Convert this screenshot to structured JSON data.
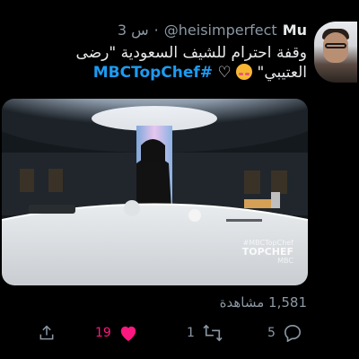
{
  "author": {
    "name": "Mu",
    "handle": "@heisimperfect",
    "time": "3 س",
    "separator": "·"
  },
  "tweet": {
    "line1": "وقفة احترام للشيف السعودية \"رضى",
    "line2": "العتيبي\"",
    "hashtag": "#MBCTopChef"
  },
  "media": {
    "watermark_hashtag": "#MBCTopChef",
    "watermark_brand": "TOPCHEF",
    "watermark_sub": "MBC"
  },
  "views": "1,581 مشاهدة",
  "actions": {
    "reply_count": "5",
    "retweet_count": "1",
    "like_count": "19",
    "share_count": ""
  },
  "colors": {
    "link": "#1d9bf0",
    "like": "#f91880",
    "muted": "#8b98a5",
    "background": "#000000"
  },
  "icons": {
    "reply": "reply-icon",
    "retweet": "retweet-icon",
    "like": "heart-icon",
    "share": "share-icon"
  }
}
